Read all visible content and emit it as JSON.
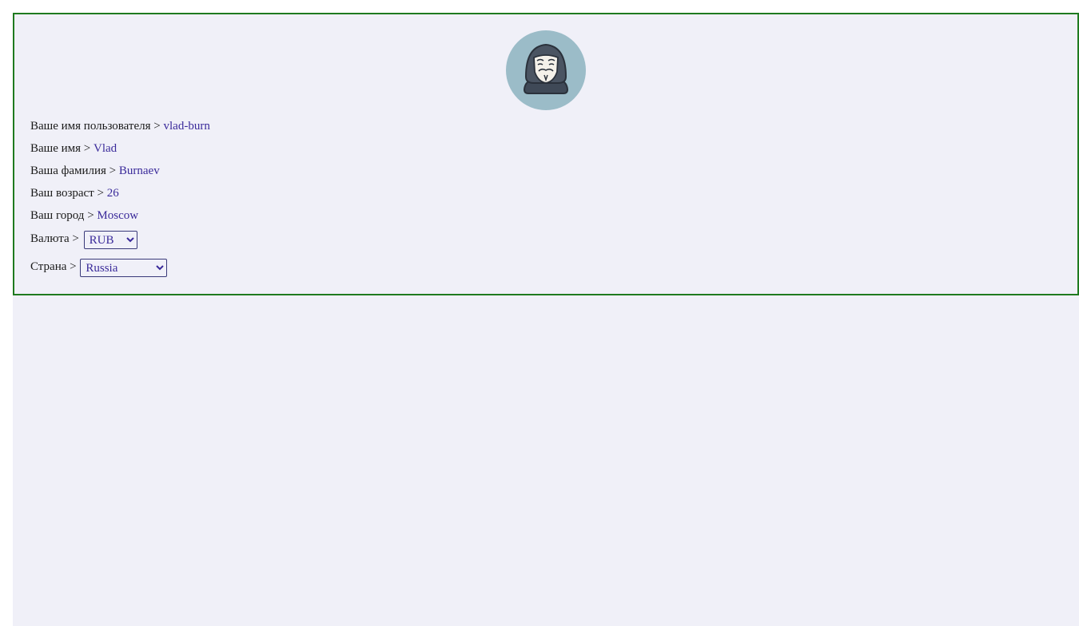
{
  "avatar": {
    "icon": "anonymous-mask-user-icon"
  },
  "profile": {
    "username_label": "Ваше имя пользователя > ",
    "username_value": "vlad-burn",
    "firstname_label": "Ваше имя > ",
    "firstname_value": "Vlad",
    "lastname_label": "Ваша фамилия > ",
    "lastname_value": "Burnaev",
    "age_label": "Ваш возраст > ",
    "age_value": "26",
    "city_label": "Ваш город > ",
    "city_value": "Moscow",
    "currency_label": "Валюта > ",
    "currency_selected": "RUB",
    "country_label": "Страна > ",
    "country_selected": "Russia"
  },
  "colors": {
    "card_border": "#1f7a1f",
    "background": "#f0f0f8",
    "value_text": "#3a2a9a",
    "avatar_bg": "#9bbcc8"
  }
}
